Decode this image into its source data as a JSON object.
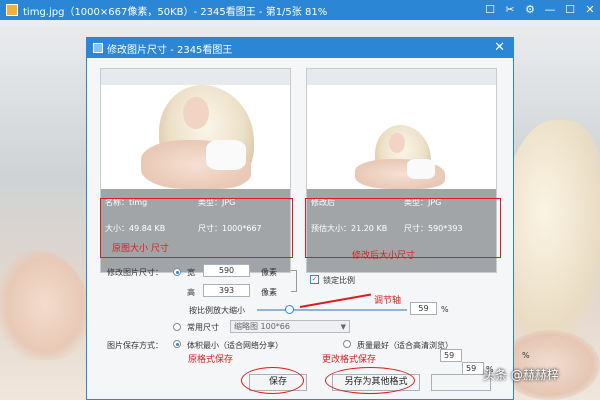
{
  "appbar": {
    "title": "timg.jpg（1000×667像素，50KB）- 2345看图王 - 第1/5张 81%",
    "controls": [
      "☐",
      "✂",
      "⚙",
      "—",
      "☐",
      "✕"
    ]
  },
  "dialog": {
    "title": "修改图片尺寸 - 2345看图王",
    "close": "✕",
    "original": {
      "name_label": "名称：timg",
      "type_label": "类型：JPG",
      "size_label": "大小：49.84 KB",
      "dims_label": "尺寸：1000*667"
    },
    "modified": {
      "name_label": "修改后",
      "type_label": "类型：JPG",
      "size_label": "预估大小：21.20 KB",
      "dims_label": "尺寸：590*393"
    },
    "resize": {
      "section_label": "修改图片尺寸：",
      "width_label": "宽",
      "width_value": "590",
      "width_unit": "像素",
      "height_label": "高",
      "height_value": "393",
      "height_unit": "像素",
      "lock_label": "锁定比例",
      "lock_checked": true,
      "scale_label": "按比例放大缩小",
      "scale_value": "59",
      "scale_unit": "%",
      "scale_fraction": 0.59,
      "common_label": "常用尺寸",
      "common_select": "缩略图 100*66"
    },
    "save_mode": {
      "section_label": "图片保存方式：",
      "opt1": "体积最小（适合网络分享）",
      "opt2": "质量最好（适合高清浏览）",
      "quality_value": "59",
      "quality_unit": "%",
      "quality_value2": "59",
      "quality_unit2": "%"
    },
    "buttons": {
      "save": "保存",
      "save_as": "另存为其他格式"
    }
  },
  "annotations": {
    "orig_size": "原图大小 尺寸",
    "mod_size": "修改后大小尺寸",
    "slider": "调节轴",
    "save_orig": "原格式保存",
    "save_other": "更改格式保存",
    "color": "#e01b1b"
  },
  "watermark": "头条 @赫赫梓"
}
